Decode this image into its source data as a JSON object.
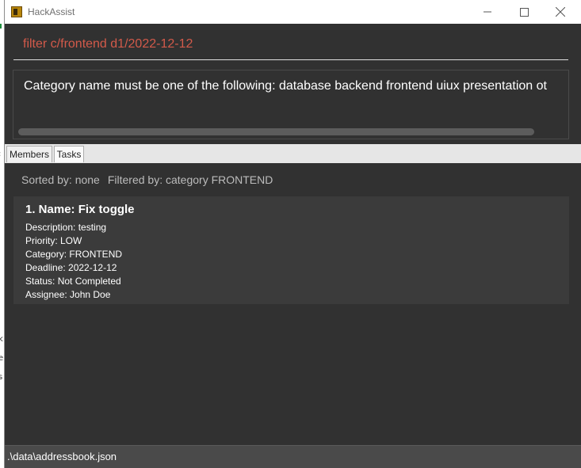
{
  "window": {
    "title": "HackAssist",
    "icon": "app-icon"
  },
  "command": {
    "value": "filter c/frontend d1/2022-12-12"
  },
  "result": {
    "message": "Category name must be one of the following:  database backend frontend uiux presentation ot"
  },
  "tabs": [
    {
      "label": "Members",
      "selected": false
    },
    {
      "label": "Tasks",
      "selected": true
    }
  ],
  "status": {
    "sorted": "Sorted by: none",
    "filtered": "Filtered by: category FRONTEND"
  },
  "tasks": [
    {
      "title": "1. Name: Fix toggle",
      "description": "Description: testing",
      "priority": "Priority: LOW",
      "category": "Category: FRONTEND",
      "deadline": "Deadline: 2022-12-12",
      "status": "Status: Not Completed",
      "assignee": "Assignee: John Doe"
    }
  ],
  "footer": {
    "path": ".\\data\\addressbook.json"
  },
  "colors": {
    "command_text": "#d35a4a",
    "background": "#313131",
    "card": "#3b3b3b"
  }
}
